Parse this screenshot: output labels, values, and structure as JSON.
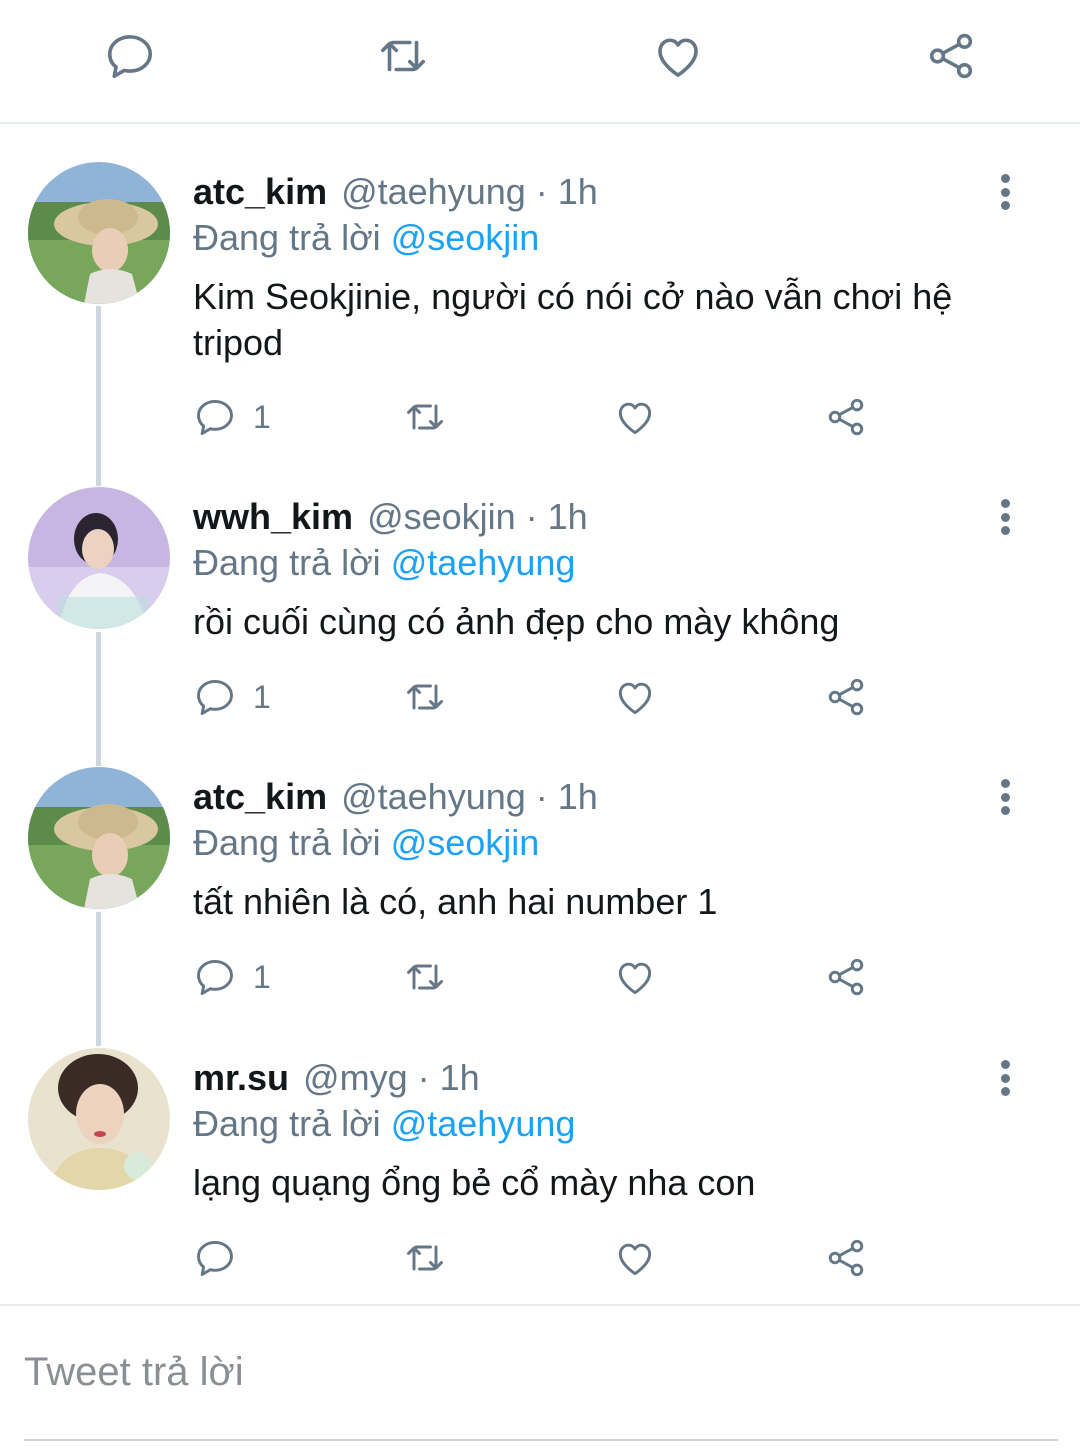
{
  "top_actions": {
    "icons": [
      "reply-icon",
      "retweet-icon",
      "like-icon",
      "share-icon"
    ],
    "icon_color": "#657786"
  },
  "colors": {
    "link": "#1da1f2",
    "muted": "#657786",
    "text": "#14171a",
    "thread_line": "#ccd6dd"
  },
  "tweets": [
    {
      "display_name": "atc_kim",
      "meta": "@taehyung · 1h",
      "reply_prefix": "Đang trả lời",
      "reply_to": "@seokjin",
      "text": "Kim Seokjinie, người có nói cở nào vẫn chơi hệ tripod",
      "reply_count": "1"
    },
    {
      "display_name": "wwh_kim",
      "meta": "@seokjin · 1h",
      "reply_prefix": "Đang trả lời",
      "reply_to": "@taehyung",
      "text": "rồi cuối cùng có ảnh đẹp cho mày không",
      "reply_count": "1"
    },
    {
      "display_name": "atc_kim",
      "meta": "@taehyung · 1h",
      "reply_prefix": "Đang trả lời",
      "reply_to": "@seokjin",
      "text": "tất nhiên là có, anh hai number 1",
      "reply_count": "1"
    },
    {
      "display_name": "mr.su",
      "meta": "@myg · 1h",
      "reply_prefix": "Đang trả lời",
      "reply_to": "@taehyung",
      "text": "lạng quạng ổng bẻ cổ mày nha con",
      "reply_count": ""
    }
  ],
  "compose": {
    "placeholder": "Tweet trả lời"
  }
}
